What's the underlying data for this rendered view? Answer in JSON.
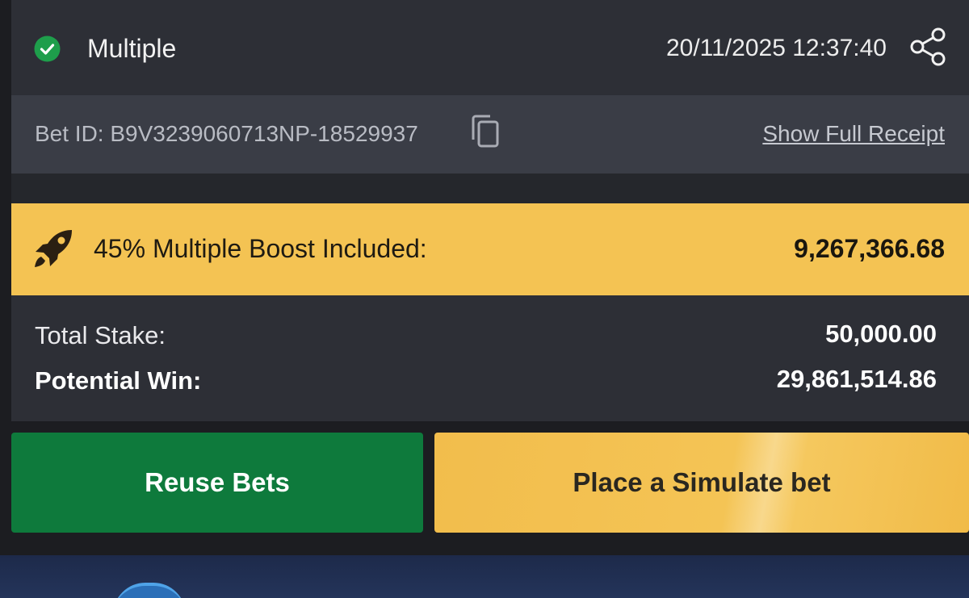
{
  "header": {
    "bet_type": "Multiple",
    "datetime": "20/11/2025 12:37:40",
    "status_color": "#1e9e4b",
    "status_icon": "check-circle-icon",
    "share_icon": "share-icon"
  },
  "bet_info": {
    "bet_id": "Bet ID: B9V3239060713NP-18529937",
    "copy_icon": "copy-icon",
    "receipt_link": "Show Full Receipt"
  },
  "boost": {
    "icon": "rocket-icon",
    "label": "45% Multiple Boost Included:",
    "value": "9,267,366.68",
    "background_color": "#f4c353"
  },
  "summary": {
    "total_stake_label": "Total Stake:",
    "total_stake_value": "50,000.00",
    "potential_win_label": "Potential Win:",
    "potential_win_value": "29,861,514.86"
  },
  "actions": {
    "reuse_label": "Reuse Bets",
    "reuse_color": "#0e7a3c",
    "simulate_label": "Place a Simulate bet",
    "simulate_color": "#f4c353"
  }
}
